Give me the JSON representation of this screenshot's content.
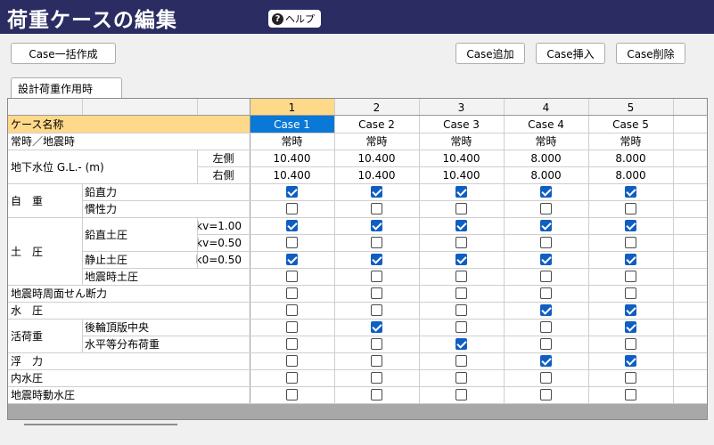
{
  "header": {
    "title": "荷重ケースの編集",
    "help_label": "ヘルプ",
    "help_icon": "question-circle-icon"
  },
  "toolbar": {
    "case_bulk_label": "Case一括作成",
    "case_add_label": "Case追加",
    "case_insert_label": "Case挿入",
    "case_delete_label": "Case削除"
  },
  "tabs": [
    {
      "label": "設計荷重作用時",
      "active": true
    }
  ],
  "grid": {
    "columns": [
      "1",
      "2",
      "3",
      "4",
      "5"
    ],
    "row_case_name_label": "ケース名称",
    "case_names": [
      "Case 1",
      "Case 2",
      "Case 3",
      "Case 4",
      "Case 5"
    ],
    "row_mode_label": "常時／地震時",
    "modes": [
      "常時",
      "常時",
      "常時",
      "常時",
      "常時"
    ],
    "groundwater": {
      "label": "地下水位 G.L.- (m)",
      "left_label": "左側",
      "right_label": "右側",
      "left_values": [
        "10.400",
        "10.400",
        "10.400",
        "8.000",
        "8.000"
      ],
      "right_values": [
        "10.400",
        "10.400",
        "10.400",
        "8.000",
        "8.000"
      ]
    },
    "self_weight": {
      "label": "自　重",
      "vertical_label": "鉛直力",
      "inertia_label": "慣性力",
      "vertical": [
        true,
        true,
        true,
        true,
        true
      ],
      "inertia": [
        false,
        false,
        false,
        false,
        false
      ]
    },
    "earth_pressure": {
      "label": "土　圧",
      "vertical_label": "鉛直土圧",
      "kv1_label": "kv=1.00",
      "kv05_label": "kv=0.50",
      "static_label": "静止土圧",
      "k0_label": "k0=0.50",
      "seismic_label": "地震時土圧",
      "kv1": [
        true,
        true,
        true,
        true,
        true
      ],
      "kv05": [
        false,
        false,
        false,
        false,
        false
      ],
      "k0": [
        true,
        true,
        true,
        true,
        true
      ],
      "seismic": [
        false,
        false,
        false,
        false,
        false
      ]
    },
    "shear": {
      "label": "地震時周面せん断力",
      "values": [
        false,
        false,
        false,
        false,
        false
      ]
    },
    "water": {
      "label": "水　圧",
      "values": [
        false,
        false,
        false,
        true,
        true
      ]
    },
    "live_load": {
      "label": "活荷重",
      "rear_label": "後輪頂版中央",
      "horizontal_label": "水平等分布荷重",
      "rear": [
        false,
        true,
        false,
        false,
        true
      ],
      "horizontal": [
        false,
        false,
        true,
        false,
        false
      ]
    },
    "buoyancy": {
      "label": "浮　力",
      "values": [
        false,
        false,
        false,
        true,
        true
      ]
    },
    "internal_water": {
      "label": "内水圧",
      "values": [
        false,
        false,
        false,
        false,
        false
      ]
    },
    "dynamic_water": {
      "label": "地震時動水圧",
      "values": [
        false,
        false,
        false,
        false,
        false
      ]
    },
    "colors": {
      "header_highlight": "#ffd98a",
      "selected": "#0a78d7",
      "checkbox_on": "#0f5ec2",
      "title_bar": "#2b2d62"
    }
  }
}
